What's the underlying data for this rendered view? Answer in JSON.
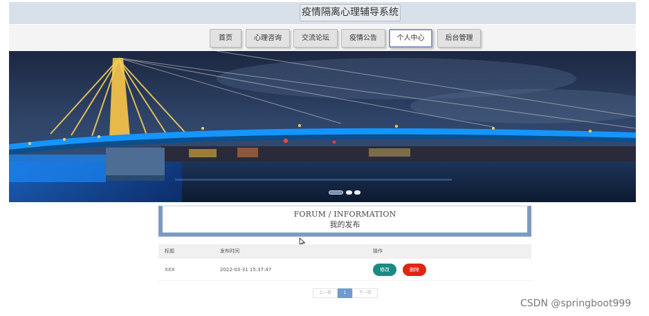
{
  "header": {
    "site_title": "疫情隔离心理辅导系统"
  },
  "nav": {
    "items": [
      {
        "label": "首页"
      },
      {
        "label": "心理咨询"
      },
      {
        "label": "交流论坛"
      },
      {
        "label": "疫情公告"
      },
      {
        "label": "个人中心",
        "active": true
      },
      {
        "label": "后台管理"
      }
    ]
  },
  "banner": {
    "slide_count": 3,
    "active_slide": 1
  },
  "section": {
    "title_en": "FORUM / INFORMATION",
    "title_cn": "我的发布"
  },
  "table": {
    "columns": [
      "标题",
      "发布时间",
      "操作"
    ],
    "rows": [
      {
        "title": "XXX",
        "time": "2022-03-31 15:37:47",
        "edit_label": "修改",
        "delete_label": "删除"
      }
    ]
  },
  "pagination": {
    "prev_label": "上一页",
    "current_page": "1",
    "next_label": "下一页"
  },
  "watermark": {
    "text": "CSDN @springboot999"
  },
  "colors": {
    "accent": "#7e9ac3",
    "edit_button": "#1a8a85",
    "delete_button": "#e02512",
    "header_bg": "#d8e0ea"
  }
}
